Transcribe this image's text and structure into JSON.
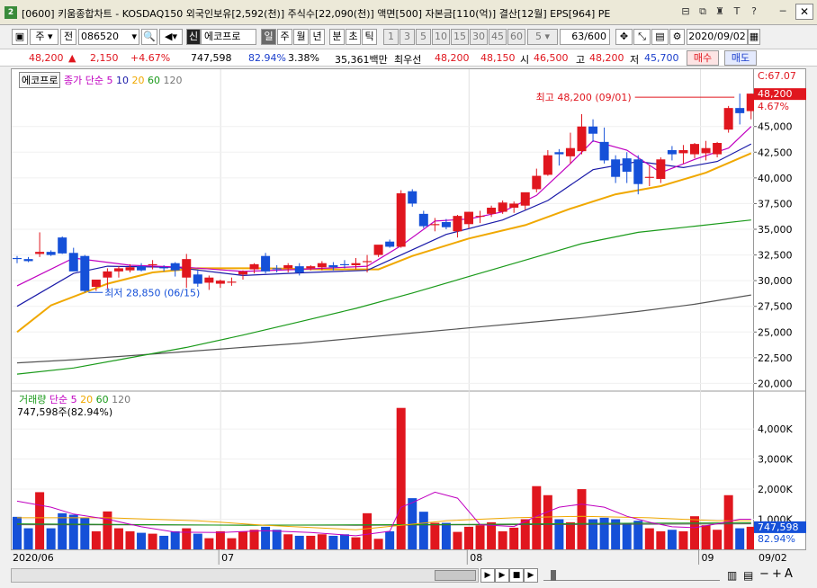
{
  "window": {
    "badge": "2",
    "title": "[0600] 키움종합차트 - KOSDAQ150 외국인보유[2,592(천)] 주식수[22,090(천)] 액면[500] 자본금[110(억)] 결산[12월] EPS[964] PE",
    "buttons": [
      "⊟",
      "⧉",
      "♜",
      "T",
      "?",
      "─"
    ],
    "close": "✕"
  },
  "toolbar": {
    "market": "주",
    "scope": "전",
    "code": "086520",
    "credit": "신",
    "name": "에코프로",
    "periods": [
      "일",
      "주",
      "월",
      "년",
      "분",
      "초",
      "틱"
    ],
    "active_period": "일",
    "intervals": [
      "1",
      "3",
      "5",
      "10",
      "15",
      "30",
      "45",
      "60"
    ],
    "interval_value": "5",
    "count": "63/600",
    "date": "2020/09/02"
  },
  "quote": {
    "price": "48,200",
    "arrow": "▲",
    "change": "2,150",
    "change_pct": "+4.67%",
    "volume": "747,598",
    "vol_ratio": "82.94%",
    "turnover": "3.38%",
    "amount": "35,361백만",
    "bid_label": "최우선",
    "bid1": "48,200",
    "bid2": "48,150",
    "open_label": "시",
    "open": "46,500",
    "high_label": "고",
    "high": "48,200",
    "low_label": "저",
    "low": "45,700",
    "buy": "매수",
    "sell": "매도"
  },
  "legend": {
    "stock_name": "에코프로",
    "main": "종가 단순",
    "ma": [
      "5",
      "10",
      "20",
      "60",
      "120"
    ],
    "vol_title": "거래량",
    "vol_main": "단순",
    "vol_ma": [
      "5",
      "20",
      "60",
      "120"
    ],
    "vol_info": "747,598주(82.94%)"
  },
  "colors": {
    "up": "#e0161e",
    "down": "#1550d8",
    "ma5": "#c000c0",
    "ma10": "#1a1aa8",
    "ma20": "#f0a800",
    "ma60": "#1a9a1a",
    "ma120": "#555555"
  },
  "chart_data": {
    "type": "candlestick",
    "price_axis_ticks": [
      "20,000",
      "22,500",
      "25,000",
      "27,500",
      "30,000",
      "32,500",
      "35,000",
      "37,500",
      "40,000",
      "42,500",
      "45,000"
    ],
    "price_ylim": [
      19600,
      49000
    ],
    "volume_axis_ticks": [
      "1,000K",
      "2,000K",
      "3,000K",
      "4,000K"
    ],
    "volume_ylim": [
      0,
      4900000
    ],
    "x_labels": [
      {
        "text": "2020/06",
        "index": 0
      },
      {
        "text": "07",
        "index": 18.5
      },
      {
        "text": "08",
        "index": 40.5
      },
      {
        "text": "09",
        "index": 61
      }
    ],
    "current_price_label": "48,200",
    "current_pct_label": "4.67%",
    "top_label": "C:67.07",
    "bottom_date": "09/02",
    "last_volume_label": "747,598",
    "last_volume_pct": "82.94%",
    "max_annotation": "최고 48,200 (09/01)",
    "min_annotation": "최저 28,850 (06/15)",
    "candles": [
      [
        32200,
        32400,
        31700,
        32100
      ],
      [
        32100,
        32300,
        31800,
        31900
      ],
      [
        32600,
        34700,
        32300,
        32800
      ],
      [
        32800,
        32950,
        32400,
        32500
      ],
      [
        34200,
        34300,
        32600,
        32650
      ],
      [
        32700,
        33200,
        31700,
        30900
      ],
      [
        32400,
        32500,
        28850,
        29000
      ],
      [
        29400,
        30100,
        29000,
        30100
      ],
      [
        30300,
        31200,
        29200,
        30900
      ],
      [
        30900,
        31400,
        30300,
        31200
      ],
      [
        31000,
        31600,
        30800,
        31300
      ],
      [
        31400,
        31700,
        30900,
        31000
      ],
      [
        31500,
        32000,
        31100,
        31600
      ],
      [
        31300,
        31500,
        30900,
        31200
      ],
      [
        31700,
        31800,
        30400,
        31000
      ],
      [
        30300,
        32600,
        29300,
        32100
      ],
      [
        30600,
        31100,
        29400,
        29700
      ],
      [
        29800,
        30500,
        29100,
        30300
      ],
      [
        29700,
        30100,
        29300,
        30000
      ],
      [
        29800,
        30300,
        29500,
        29900
      ],
      [
        30600,
        31000,
        30100,
        30900
      ],
      [
        31100,
        31700,
        30700,
        31600
      ],
      [
        32400,
        32700,
        30700,
        30900
      ],
      [
        31200,
        31500,
        30800,
        31100
      ],
      [
        31200,
        31700,
        30800,
        31500
      ],
      [
        31400,
        31700,
        30500,
        30800
      ],
      [
        31200,
        31500,
        31000,
        31400
      ],
      [
        31300,
        31900,
        31000,
        31700
      ],
      [
        31500,
        31800,
        31000,
        31300
      ],
      [
        31600,
        32000,
        31200,
        31500
      ],
      [
        31500,
        32200,
        31100,
        31700
      ],
      [
        31800,
        32500,
        30800,
        31900
      ],
      [
        32500,
        33400,
        32300,
        33500
      ],
      [
        33800,
        34000,
        33200,
        33300
      ],
      [
        33300,
        38800,
        33200,
        38500
      ],
      [
        38700,
        38900,
        37200,
        37500
      ],
      [
        36500,
        36800,
        35100,
        35300
      ],
      [
        35400,
        36100,
        34800,
        35500
      ],
      [
        35700,
        36000,
        35000,
        35200
      ],
      [
        34800,
        36400,
        34200,
        36300
      ],
      [
        35500,
        36700,
        35100,
        36700
      ],
      [
        36300,
        36800,
        35600,
        36300
      ],
      [
        36500,
        37300,
        36200,
        37100
      ],
      [
        36700,
        37800,
        36500,
        37600
      ],
      [
        37100,
        37700,
        36600,
        37500
      ],
      [
        37300,
        38400,
        36900,
        38600
      ],
      [
        38900,
        40900,
        38600,
        40200
      ],
      [
        40300,
        42700,
        40200,
        42200
      ],
      [
        42500,
        42800,
        41200,
        42300
      ],
      [
        42100,
        44400,
        41400,
        42900
      ],
      [
        42600,
        46200,
        42300,
        45000
      ],
      [
        45000,
        45700,
        43500,
        44300
      ],
      [
        43500,
        44900,
        41400,
        41700
      ],
      [
        41800,
        42200,
        39500,
        40100
      ],
      [
        41900,
        42500,
        39500,
        40600
      ],
      [
        41800,
        42200,
        38400,
        39400
      ],
      [
        40000,
        41200,
        39200,
        40100
      ],
      [
        39900,
        42000,
        39500,
        41800
      ],
      [
        42700,
        43100,
        41700,
        42300
      ],
      [
        42400,
        43200,
        41400,
        42700
      ],
      [
        42300,
        43400,
        41900,
        43300
      ],
      [
        42400,
        43600,
        41700,
        42900
      ],
      [
        42300,
        43500,
        42000,
        43400
      ],
      [
        44700,
        47000,
        44400,
        46800
      ],
      [
        46800,
        48200,
        45200,
        46300
      ],
      [
        46500,
        48200,
        45700,
        48200
      ]
    ],
    "volumes": [
      1080000,
      700000,
      1900000,
      700000,
      1200000,
      1150000,
      1050000,
      600000,
      1260000,
      700000,
      600000,
      550000,
      520000,
      450000,
      600000,
      700000,
      520000,
      370000,
      600000,
      370000,
      600000,
      650000,
      750000,
      650000,
      500000,
      450000,
      450000,
      500000,
      450000,
      500000,
      400000,
      1200000,
      350000,
      600000,
      4700000,
      1700000,
      1250000,
      880000,
      880000,
      580000,
      750000,
      800000,
      900000,
      600000,
      720000,
      1000000,
      2100000,
      1800000,
      1000000,
      900000,
      2000000,
      1000000,
      1050000,
      1000000,
      870000,
      950000,
      700000,
      600000,
      650000,
      600000,
      1100000,
      800000,
      650000,
      1800000,
      700000,
      750000
    ],
    "ma": {
      "ma5": [
        [
          0,
          29500
        ],
        [
          5,
          32200
        ],
        [
          10,
          31500
        ],
        [
          15,
          31300
        ],
        [
          20,
          30900
        ],
        [
          25,
          31100
        ],
        [
          31,
          31400
        ],
        [
          34,
          33400
        ],
        [
          37,
          35800
        ],
        [
          40,
          36000
        ],
        [
          43,
          36700
        ],
        [
          46,
          38300
        ],
        [
          49,
          41400
        ],
        [
          51,
          43600
        ],
        [
          54,
          42700
        ],
        [
          57,
          40500
        ],
        [
          60,
          41800
        ],
        [
          63,
          42900
        ],
        [
          65,
          45000
        ]
      ],
      "ma10": [
        [
          0,
          27500
        ],
        [
          5,
          30700
        ],
        [
          8,
          31400
        ],
        [
          14,
          31300
        ],
        [
          20,
          30500
        ],
        [
          26,
          30800
        ],
        [
          31,
          31000
        ],
        [
          34,
          32500
        ],
        [
          38,
          34500
        ],
        [
          43,
          35900
        ],
        [
          47,
          37800
        ],
        [
          51,
          40800
        ],
        [
          55,
          41600
        ],
        [
          59,
          41000
        ],
        [
          62,
          41600
        ],
        [
          65,
          43300
        ]
      ],
      "ma20": [
        [
          0,
          25000
        ],
        [
          3,
          27600
        ],
        [
          8,
          29700
        ],
        [
          12,
          30800
        ],
        [
          16,
          31200
        ],
        [
          22,
          31200
        ],
        [
          27,
          31100
        ],
        [
          32,
          31100
        ],
        [
          35,
          32400
        ],
        [
          40,
          34100
        ],
        [
          45,
          35400
        ],
        [
          49,
          37000
        ],
        [
          53,
          38400
        ],
        [
          57,
          39200
        ],
        [
          61,
          40500
        ],
        [
          65,
          42400
        ]
      ],
      "ma60": [
        [
          0,
          20900
        ],
        [
          5,
          21500
        ],
        [
          10,
          22500
        ],
        [
          15,
          23500
        ],
        [
          20,
          24700
        ],
        [
          25,
          26000
        ],
        [
          30,
          27300
        ],
        [
          35,
          28800
        ],
        [
          40,
          30400
        ],
        [
          45,
          32000
        ],
        [
          50,
          33600
        ],
        [
          55,
          34700
        ],
        [
          60,
          35300
        ],
        [
          65,
          35900
        ]
      ],
      "ma120": [
        [
          0,
          22000
        ],
        [
          5,
          22300
        ],
        [
          10,
          22700
        ],
        [
          15,
          23100
        ],
        [
          20,
          23500
        ],
        [
          25,
          23900
        ],
        [
          30,
          24400
        ],
        [
          35,
          24900
        ],
        [
          40,
          25400
        ],
        [
          45,
          25900
        ],
        [
          50,
          26400
        ],
        [
          55,
          27000
        ],
        [
          60,
          27700
        ],
        [
          65,
          28600
        ]
      ],
      "vol_ma5": [
        [
          0,
          1600000
        ],
        [
          3,
          1400000
        ],
        [
          5,
          1170000
        ],
        [
          8,
          1000000
        ],
        [
          11,
          750000
        ],
        [
          14,
          570000
        ],
        [
          18,
          560000
        ],
        [
          22,
          620000
        ],
        [
          26,
          560000
        ],
        [
          30,
          450000
        ],
        [
          33,
          600000
        ],
        [
          34,
          1400000
        ],
        [
          35,
          1550000
        ],
        [
          37,
          1900000
        ],
        [
          39,
          1700000
        ],
        [
          41,
          820000
        ],
        [
          44,
          760000
        ],
        [
          46,
          1100000
        ],
        [
          48,
          1400000
        ],
        [
          50,
          1500000
        ],
        [
          52,
          1400000
        ],
        [
          54,
          1100000
        ],
        [
          56,
          900000
        ],
        [
          58,
          750000
        ],
        [
          60,
          720000
        ],
        [
          62,
          850000
        ],
        [
          64,
          1000000
        ],
        [
          65,
          1000000
        ]
      ],
      "vol_ma20": [
        [
          0,
          1050000
        ],
        [
          8,
          1050000
        ],
        [
          16,
          950000
        ],
        [
          22,
          800000
        ],
        [
          30,
          650000
        ],
        [
          34,
          800000
        ],
        [
          38,
          950000
        ],
        [
          44,
          1050000
        ],
        [
          50,
          1100000
        ],
        [
          56,
          1050000
        ],
        [
          62,
          950000
        ],
        [
          65,
          950000
        ]
      ],
      "vol_ma60": [
        [
          0,
          850000
        ],
        [
          20,
          800000
        ],
        [
          40,
          830000
        ],
        [
          55,
          870000
        ],
        [
          65,
          880000
        ]
      ],
      "vol_ma120": [
        [
          0,
          820000
        ],
        [
          30,
          800000
        ],
        [
          65,
          850000
        ]
      ]
    }
  },
  "bottom": {
    "zoom_minus": "−",
    "zoom_plus": "+",
    "font_up": "A",
    "font_down": "A"
  }
}
